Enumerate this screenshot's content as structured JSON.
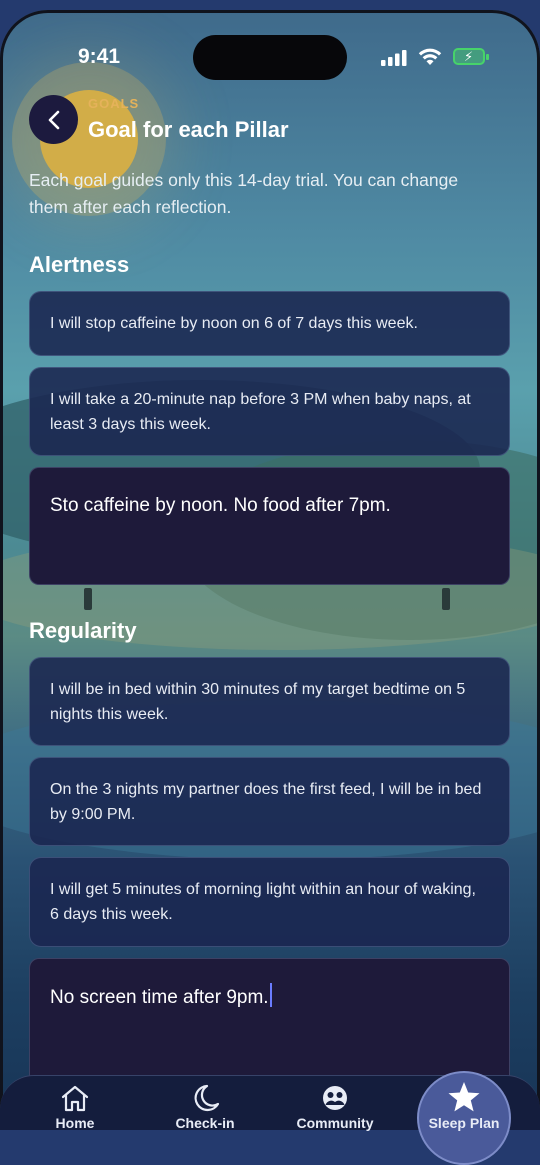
{
  "status_bar": {
    "time": "9:41"
  },
  "header": {
    "eyebrow": "GOALS",
    "title": "Goal for each Pillar",
    "intro": "Each goal guides only this 14-day trial. You can change them after each reflection."
  },
  "sections": [
    {
      "title": "Alertness",
      "goals": [
        "I will stop caffeine by noon on 6 of 7 days this week.",
        "I will take a 20-minute nap before 3 PM when baby naps, at least 3 days this week."
      ],
      "custom_input": "Sto caffeine by noon.  No food after 7pm."
    },
    {
      "title": "Regularity",
      "goals": [
        "I will be in bed within 30 minutes of my target bedtime on 5 nights this week.",
        "On the 3 nights my partner does the first feed, I will be in bed by 9:00 PM.",
        "I will get 5 minutes of morning light within an hour of waking, 6 days this week."
      ],
      "custom_input": "No screen time after 9pm."
    }
  ],
  "tab_bar": {
    "active": "Sleep Plan",
    "tabs": [
      {
        "label": "Home",
        "icon": "home-icon"
      },
      {
        "label": "Check-in",
        "icon": "moon-icon"
      },
      {
        "label": "Community",
        "icon": "community-icon"
      },
      {
        "label": "Sleep Plan",
        "icon": "star-icon"
      }
    ]
  },
  "colors": {
    "accent": "#e5b25a",
    "card_bg": "#1a2650",
    "input_bg": "#1e1a3a",
    "tab_bar_bg": "#141d3d",
    "battery": "#47d36a"
  }
}
